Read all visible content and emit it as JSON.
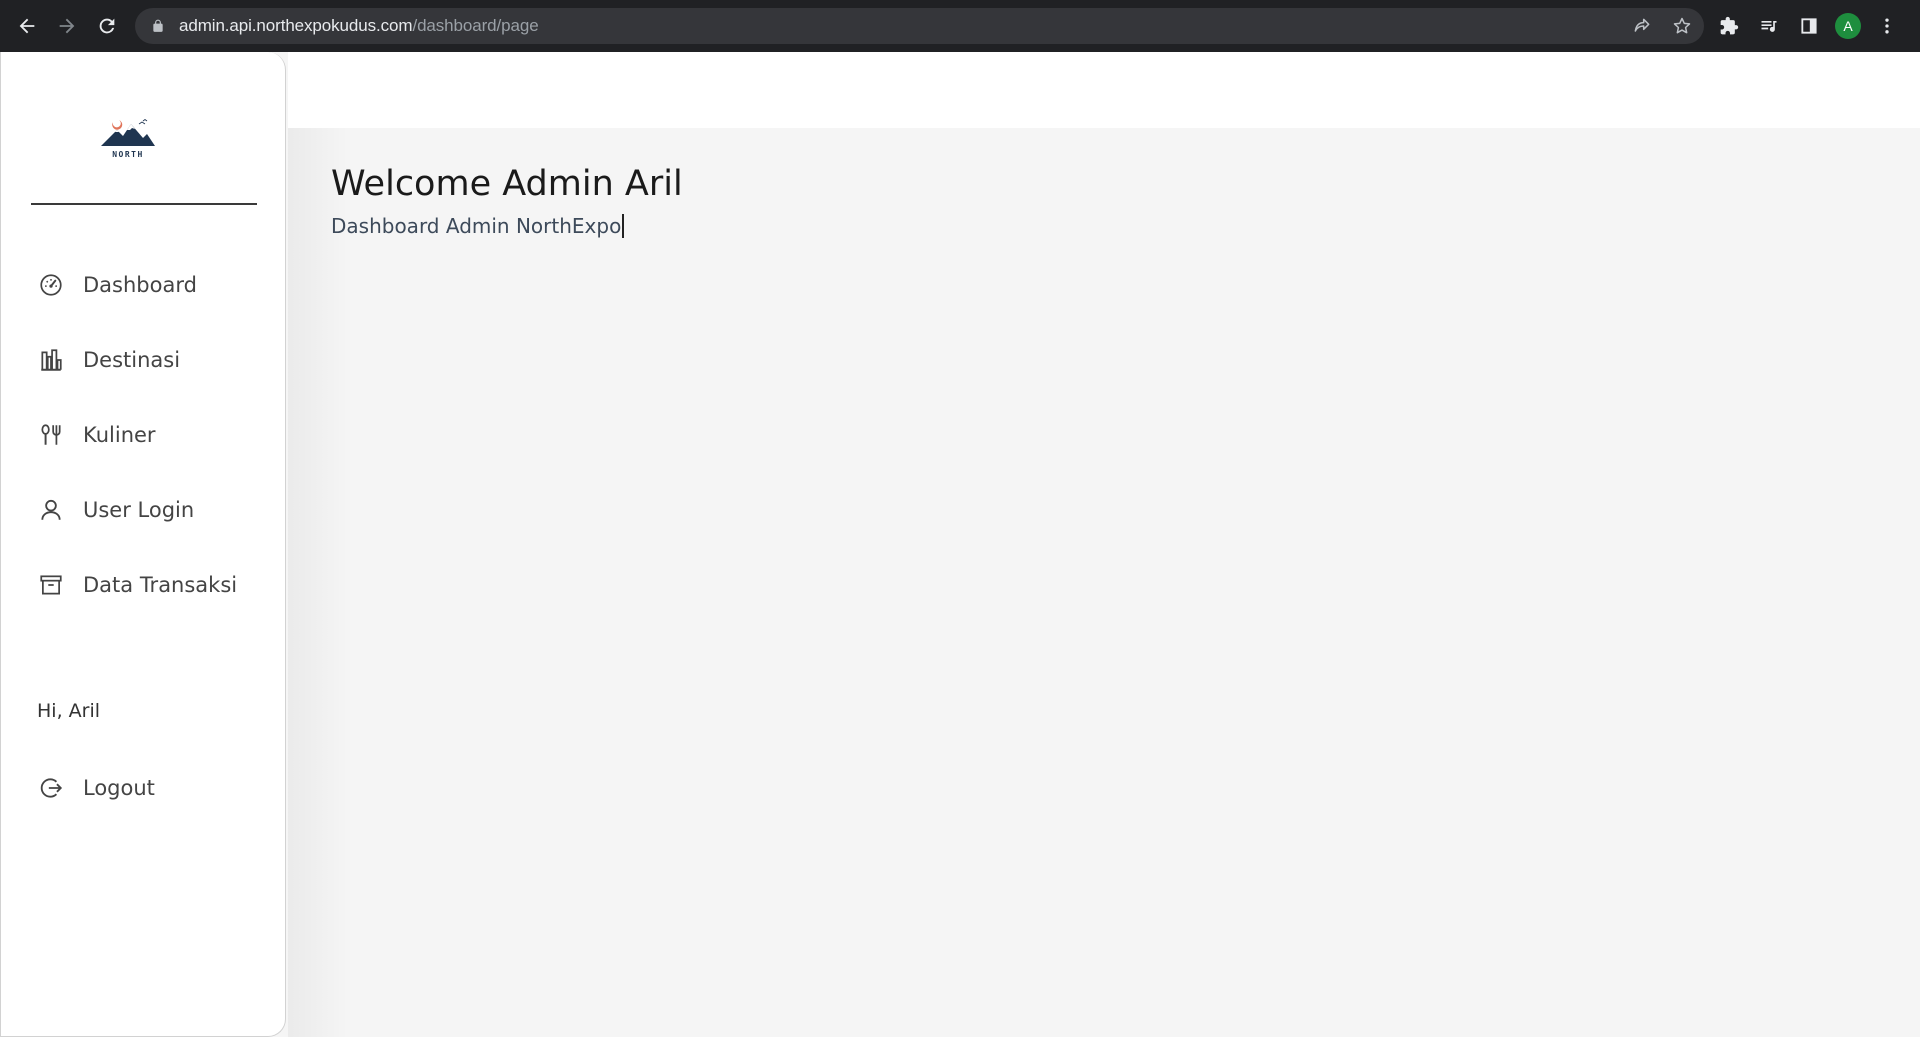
{
  "browser": {
    "url_host": "admin.api.northexpokudus.com",
    "url_path": "/dashboard/page",
    "profile_initial": "A"
  },
  "sidebar": {
    "logo_text": "NORTH",
    "items": [
      {
        "label": "Dashboard",
        "icon": "gauge-icon"
      },
      {
        "label": "Destinasi",
        "icon": "buildings-icon"
      },
      {
        "label": "Kuliner",
        "icon": "fork-spoon-icon"
      },
      {
        "label": "User Login",
        "icon": "user-icon"
      },
      {
        "label": "Data Transaksi",
        "icon": "archive-icon"
      }
    ],
    "greeting": "Hi, Aril",
    "logout_label": "Logout"
  },
  "main": {
    "title": "Welcome Admin Aril",
    "subtitle": "Dashboard Admin NorthExpo"
  },
  "colors": {
    "chrome_bg": "#202124",
    "omnibox_bg": "#35363a",
    "page_bg": "#f5f5f5",
    "sidebar_bg": "#ffffff",
    "text_dark": "#1a1a1a",
    "avatar_green": "#1e8e3e"
  }
}
